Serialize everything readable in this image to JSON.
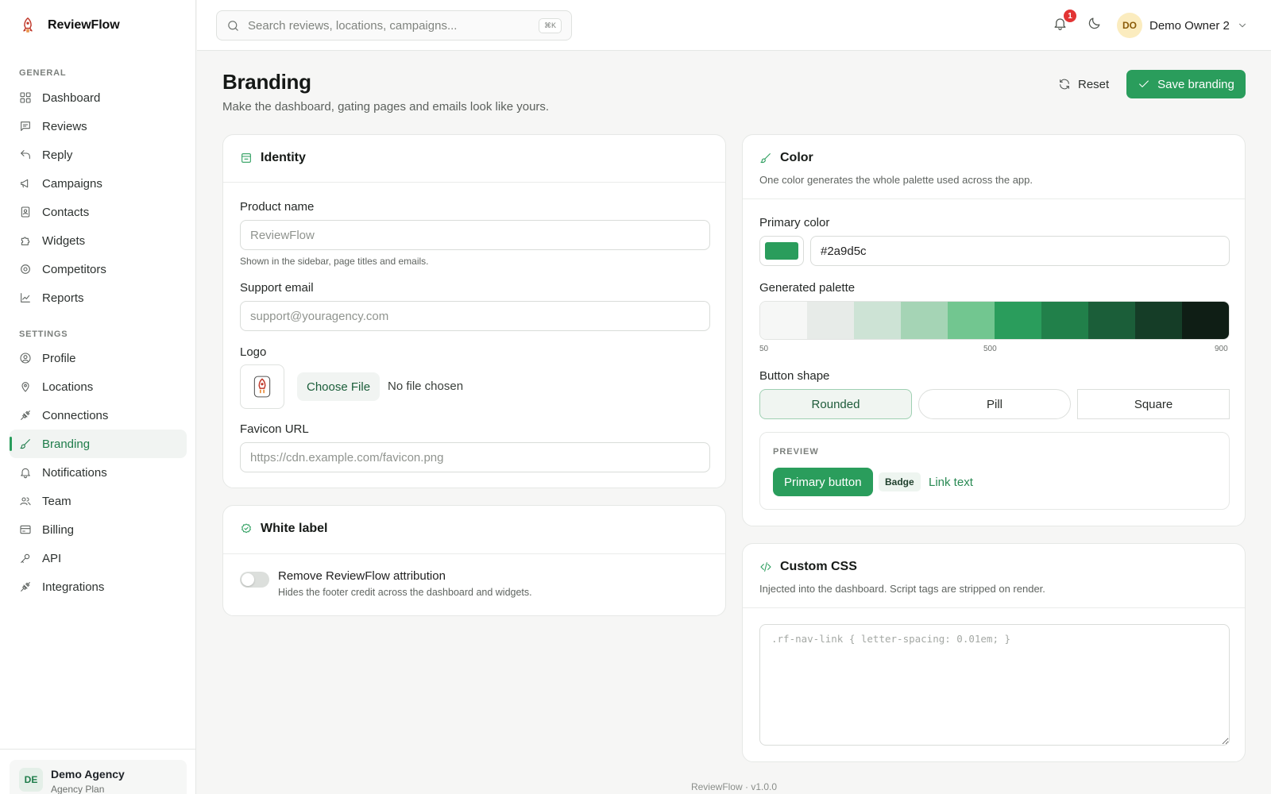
{
  "brand": {
    "name": "ReviewFlow"
  },
  "sidebar": {
    "general_label": "GENERAL",
    "settings_label": "SETTINGS",
    "general": [
      {
        "label": "Dashboard",
        "icon": "grid-icon"
      },
      {
        "label": "Reviews",
        "icon": "message-square-icon"
      },
      {
        "label": "Reply",
        "icon": "reply-icon"
      },
      {
        "label": "Campaigns",
        "icon": "megaphone-icon"
      },
      {
        "label": "Contacts",
        "icon": "contact-book-icon"
      },
      {
        "label": "Widgets",
        "icon": "puzzle-icon"
      },
      {
        "label": "Competitors",
        "icon": "target-icon"
      },
      {
        "label": "Reports",
        "icon": "line-chart-icon"
      }
    ],
    "settings": [
      {
        "label": "Profile",
        "icon": "user-circle-icon"
      },
      {
        "label": "Locations",
        "icon": "map-pin-icon"
      },
      {
        "label": "Connections",
        "icon": "plug-icon"
      },
      {
        "label": "Branding",
        "icon": "brush-icon",
        "active": true
      },
      {
        "label": "Notifications",
        "icon": "bell-icon"
      },
      {
        "label": "Team",
        "icon": "users-icon"
      },
      {
        "label": "Billing",
        "icon": "credit-card-icon"
      },
      {
        "label": "API",
        "icon": "key-icon"
      },
      {
        "label": "Integrations",
        "icon": "plug-icon"
      }
    ],
    "org": {
      "initials": "DE",
      "name": "Demo Agency",
      "plan": "Agency Plan"
    }
  },
  "topbar": {
    "search_placeholder": "Search reviews, locations, campaigns...",
    "shortcut": "⌘K",
    "notification_count": "1",
    "user": {
      "initials": "DO",
      "name": "Demo Owner 2"
    }
  },
  "page": {
    "title": "Branding",
    "subtitle": "Make the dashboard, gating pages and emails look like yours.",
    "reset_label": "Reset",
    "save_label": "Save branding"
  },
  "identity": {
    "title": "Identity",
    "product_name_label": "Product name",
    "product_name_placeholder": "ReviewFlow",
    "product_name_hint": "Shown in the sidebar, page titles and emails.",
    "support_email_label": "Support email",
    "support_email_placeholder": "support@youragency.com",
    "logo_label": "Logo",
    "choose_file_label": "Choose File",
    "no_file_label": "No file chosen",
    "favicon_label": "Favicon URL",
    "favicon_placeholder": "https://cdn.example.com/favicon.png"
  },
  "white_label": {
    "title": "White label",
    "toggle_title": "Remove ReviewFlow attribution",
    "toggle_desc": "Hides the footer credit across the dashboard and widgets.",
    "enabled": false
  },
  "color": {
    "title": "Color",
    "desc": "One color generates the whole palette used across the app.",
    "primary_label": "Primary color",
    "primary_value": "#2a9d5c",
    "palette_label": "Generated palette",
    "palette": [
      "#f6f7f6",
      "#e7ebe8",
      "#cde3d5",
      "#a5d4b5",
      "#72c690",
      "#2a9d5c",
      "#21804a",
      "#1b5e39",
      "#153d27",
      "#0f1e15"
    ],
    "palette_ticks": [
      "50",
      "500",
      "900"
    ],
    "shape_label": "Button shape",
    "shapes": [
      {
        "label": "Rounded",
        "selected": true
      },
      {
        "label": "Pill",
        "selected": false
      },
      {
        "label": "Square",
        "selected": false
      }
    ],
    "preview_label": "PREVIEW",
    "preview_button": "Primary button",
    "preview_badge": "Badge",
    "preview_link": "Link text"
  },
  "custom_css": {
    "title": "Custom CSS",
    "desc": "Injected into the dashboard. Script tags are stripped on render.",
    "placeholder": ".rf-nav-link { letter-spacing: 0.01em; }"
  },
  "footer": {
    "text": "ReviewFlow · v1.0.0"
  }
}
